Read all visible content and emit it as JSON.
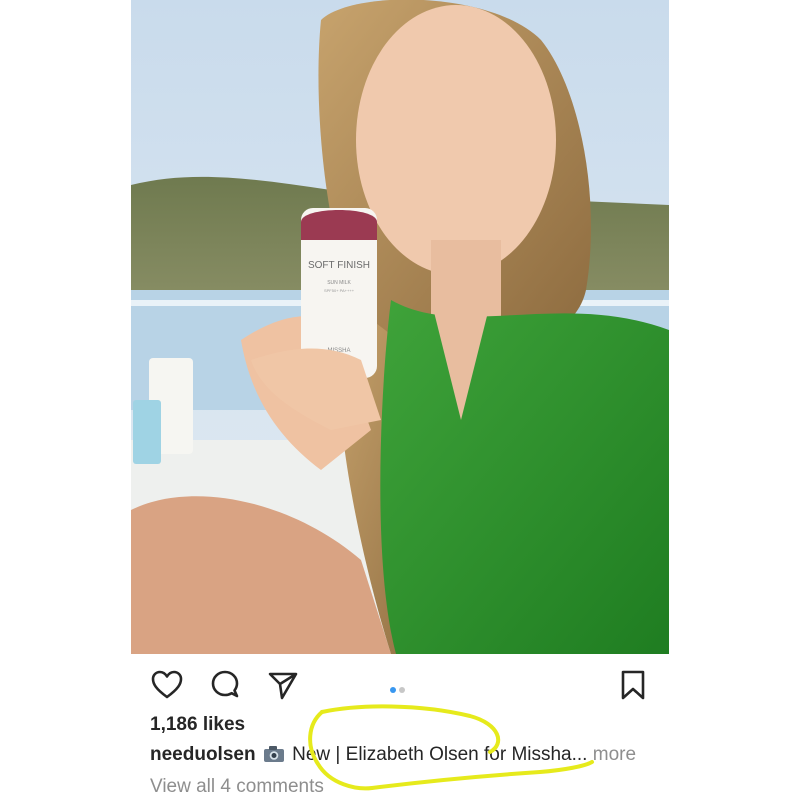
{
  "post": {
    "likes_text": "1,186 likes",
    "username": "needuolsen",
    "caption_emoji": "camera-emoji",
    "caption_text": " New | Elizabeth Olsen for Missha...",
    "more_label": " more",
    "view_comments_label": "View all 4 comments",
    "carousel": {
      "count": 2,
      "active_index": 0
    },
    "image": {
      "product_name": "SOFT FINISH",
      "product_sub": "SUN MILK",
      "product_sub2": "SPF50+ PA++++",
      "brand": "MISSHA"
    }
  },
  "icons": {
    "like": "heart-icon",
    "comment": "comment-icon",
    "share": "paper-plane-icon",
    "save": "bookmark-icon"
  },
  "colors": {
    "text": "#262626",
    "secondary_text": "#8e8e8e",
    "active_dot": "#3897f0",
    "inactive_dot": "#c7c7c7",
    "highlight": "#e6ea1c"
  }
}
